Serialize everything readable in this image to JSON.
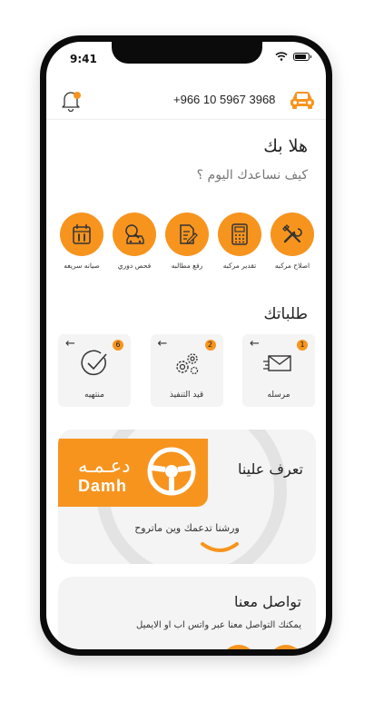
{
  "status_bar": {
    "time": "9:41"
  },
  "header": {
    "phone": "+966 10 5967 3968",
    "logo_icon": "car-icon",
    "bell_icon": "bell-icon"
  },
  "greeting": {
    "title": "هلا بك",
    "subtitle": "كيف نساعدك اليوم ؟"
  },
  "services": [
    {
      "label": "اصلاح مركبه",
      "icon": "tools-icon"
    },
    {
      "label": "تقدير مركبه",
      "icon": "calculator-icon"
    },
    {
      "label": "رفع مطالبه",
      "icon": "document-edit-icon"
    },
    {
      "label": "فحص دوري",
      "icon": "car-inspection-icon"
    },
    {
      "label": "صيانه سريعه",
      "icon": "calendar-tools-icon"
    }
  ],
  "orders": {
    "title": "طلباتك",
    "items": [
      {
        "label": "مرسله",
        "count": "1",
        "icon": "mail-icon",
        "arrow": "←"
      },
      {
        "label": "قيد التنفيذ",
        "count": "2",
        "icon": "gears-icon",
        "arrow": "←"
      },
      {
        "label": "منتهيه",
        "count": "6",
        "icon": "check-circle-icon",
        "arrow": "←"
      }
    ]
  },
  "about": {
    "title": "تعرف علينا",
    "brand_ar": "دعـمـه",
    "brand_en": "Damh",
    "tagline": "ورشنا تدعمك وين ماتروح"
  },
  "contact": {
    "title": "تواصل معنا",
    "subtitle": "يمكنك التواصل معنا عبر واتس اب او الايميل"
  },
  "colors": {
    "accent": "#f7941e",
    "card": "#f4f4f4",
    "text": "#222222"
  }
}
